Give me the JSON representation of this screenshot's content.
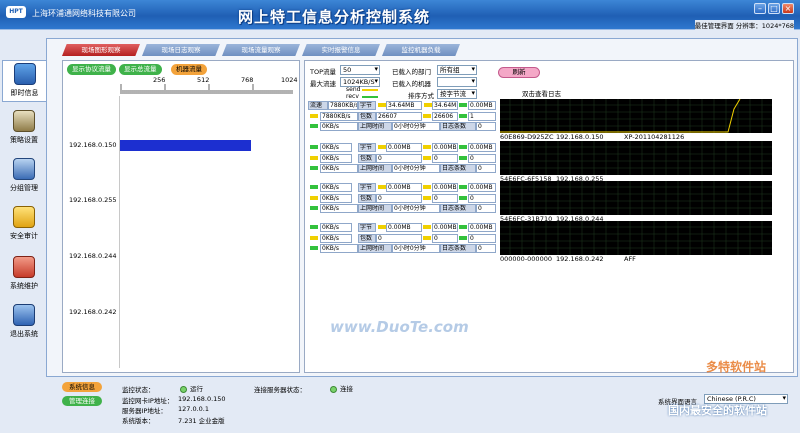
{
  "window": {
    "company": "上海环浦通网络科技有限公司",
    "title": "网上特工信息分析控制系统",
    "subinfo": "最佳管理界面  分辨率：1024*768"
  },
  "sidebar": {
    "items": [
      {
        "label": "即时信息",
        "icon": "monitor-icon"
      },
      {
        "label": "策略设置",
        "icon": "policy-icon"
      },
      {
        "label": "分组管理",
        "icon": "group-icon"
      },
      {
        "label": "安全审计",
        "icon": "audit-icon"
      },
      {
        "label": "系统维护",
        "icon": "maintenance-icon"
      },
      {
        "label": "退出系统",
        "icon": "exit-icon"
      }
    ]
  },
  "tabs": [
    "现场图形观察",
    "现场日志观察",
    "现场流量观察",
    "实时报警信息",
    "监控机器负载"
  ],
  "left_panel": {
    "btn_protocol": "显示协议流量",
    "btn_total": "显示总流量",
    "btn_machine": "机器流量",
    "ruler_ticks": [
      "256",
      "512",
      "768",
      "1024"
    ],
    "ips": [
      "192.168.0.150",
      "192.168.0.255",
      "192.168.0.244",
      "192.168.0.242"
    ],
    "bar_fraction": 0.75
  },
  "right_panel": {
    "top_label": "TOP流量",
    "top_value": "50",
    "max_label": "最大流速",
    "max_value": "1024KB/S",
    "dept_label": "已载入的部门",
    "dept_value": "所有组",
    "machine_label": "已载入的机器",
    "sort_label": "排序方式",
    "sort_value": "按字节流",
    "refresh": "刷新",
    "dblclick_hint": "双击查看日志",
    "send": "send",
    "recv": "recv",
    "hosts": [
      {
        "r1": [
          "流速",
          "7880KB/s",
          "字节",
          "34.64MB",
          "34.64MB",
          "0.00MB"
        ],
        "r2": [
          "7880KB/s",
          "包数",
          "26607",
          "26606",
          "1"
        ],
        "r3": [
          "0KB/s",
          "上网时间",
          "0小时0分钟",
          "日志条数",
          "0"
        ],
        "caption": [
          "60E869-D925ZC",
          "192.168.0.150",
          "XP-201104281126"
        ]
      },
      {
        "r1": [
          "0KB/s",
          "字节",
          "0.00MB",
          "0.00MB",
          "0.00MB"
        ],
        "r2": [
          "0KB/s",
          "包数",
          "0",
          "0",
          "0"
        ],
        "r3": [
          "0KB/s",
          "上网时间",
          "0小时0分钟",
          "日志条数",
          "0"
        ],
        "caption": [
          "54E6FC-6F5158",
          "192.168.0.255",
          ""
        ]
      },
      {
        "r1": [
          "0KB/s",
          "字节",
          "0.00MB",
          "0.00MB",
          "0.00MB"
        ],
        "r2": [
          "0KB/s",
          "包数",
          "0",
          "0",
          "0"
        ],
        "r3": [
          "0KB/s",
          "上网时间",
          "0小时0分钟",
          "日志条数",
          "0"
        ],
        "caption": [
          "54E6FC-31B710",
          "192.168.0.244",
          ""
        ]
      },
      {
        "r1": [
          "0KB/s",
          "字节",
          "0.00MB",
          "0.00MB",
          "0.00MB"
        ],
        "r2": [
          "0KB/s",
          "包数",
          "0",
          "0",
          "0"
        ],
        "r3": [
          "0KB/s",
          "上网时间",
          "0小时0分钟",
          "日志条数",
          "0"
        ],
        "caption": [
          "000000-000000",
          "192.168.0.242",
          "AFF"
        ]
      }
    ]
  },
  "footer": {
    "btn_sysinfo": "系统信息",
    "btn_mgmt": "管理连接",
    "monitor_status_label": "监控状态：",
    "monitor_status": "运行",
    "nic_ip_label": "监控网卡IP地址：",
    "nic_ip": "192.168.0.150",
    "server_ip_label": "服务器IP地址：",
    "server_ip": "127.0.0.1",
    "version_label": "系统版本：",
    "version": "7.231  企业金版",
    "conn_label": "连接服务器状态：",
    "conn_status": "连接",
    "lang_label": "系统界面语言",
    "lang_value": "Chinese (P.R.C)"
  },
  "watermarks": {
    "site": "www.DuoTe.com",
    "brand": "多特软件站",
    "slogan": "国内最安全的软件站"
  },
  "colors": {
    "titlebar": "#2f78cf",
    "active_tab": "#c02828",
    "bar": "#1c2fd0",
    "graph_bg": "#000000",
    "graph_line": "#f0d000"
  }
}
